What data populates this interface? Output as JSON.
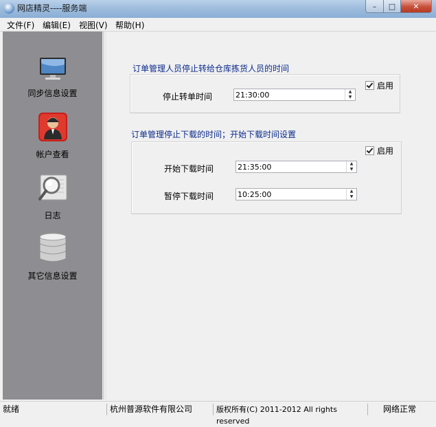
{
  "window": {
    "title": "网店精灵----服务端",
    "min_symbol": "–",
    "max_symbol": "□",
    "close_symbol": "✕"
  },
  "menu": [
    "文件(F)",
    "编辑(E)",
    "视图(V)",
    "帮助(H)"
  ],
  "sidebar": {
    "items": [
      {
        "label": "同步信息设置",
        "icon": "monitor-icon"
      },
      {
        "label": "帐户查看",
        "icon": "user-account-icon"
      },
      {
        "label": "日志",
        "icon": "magnifier-log-icon"
      },
      {
        "label": "其它信息设置",
        "icon": "database-icon"
      }
    ]
  },
  "group1": {
    "title": "订单管理人员停止转给仓库拣货人员的时间",
    "enable_label": "启用",
    "enabled": true,
    "stop_label": "停止转单时间",
    "stop_value": "21:30:00"
  },
  "group2": {
    "title": "订单管理停止下载的时间；开始下载时间设置",
    "enable_label": "启用",
    "enabled": true,
    "start_label": "开始下载时间",
    "start_value": "21:35:00",
    "pause_label": "暂停下载时间",
    "pause_value": "10:25:00"
  },
  "spinner": {
    "up": "▲",
    "down": "▼"
  },
  "status": {
    "ready": "就绪",
    "company": "杭州普源软件有限公司",
    "copyright": "版权所有(C) 2011-2012 All rights reserved",
    "network": "网络正常"
  },
  "colors": {
    "sidebar_bg": "#8e8e92",
    "group_title": "#0b2b8c",
    "titlebar": "#9fbddd"
  }
}
